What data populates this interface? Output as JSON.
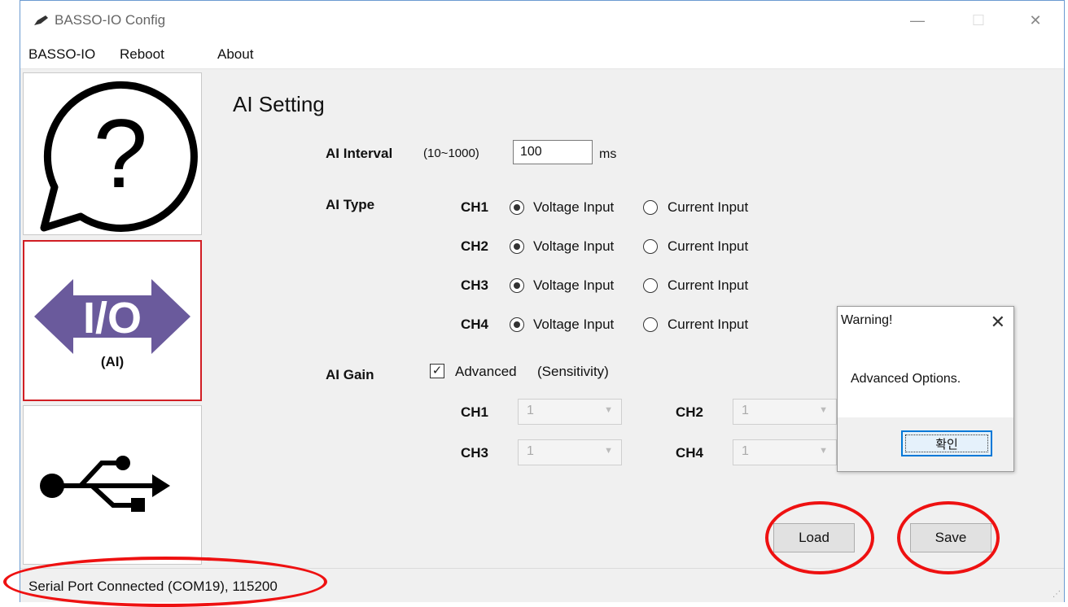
{
  "window": {
    "title": "BASSO-IO Config",
    "controls": {
      "minimize": "—",
      "maximize": "☐",
      "close": "✕"
    }
  },
  "menu": {
    "items": [
      "BASSO-IO",
      "Reboot",
      "About"
    ]
  },
  "sidebar": {
    "items": [
      {
        "name": "help",
        "icon": "question-bubble-icon"
      },
      {
        "name": "ai-io",
        "icon": "io-arrow-icon",
        "caption": "(AI)",
        "selected": true
      },
      {
        "name": "usb",
        "icon": "usb-icon"
      }
    ]
  },
  "main": {
    "section_title": "AI Setting",
    "interval": {
      "label": "AI Interval",
      "range": "(10~1000)",
      "value": "100",
      "unit": "ms"
    },
    "type": {
      "label": "AI Type",
      "option_labels": [
        "Voltage Input",
        "Current Input"
      ],
      "channels": [
        {
          "name": "CH1",
          "selected": "Voltage Input"
        },
        {
          "name": "CH2",
          "selected": "Voltage Input"
        },
        {
          "name": "CH3",
          "selected": "Voltage Input"
        },
        {
          "name": "CH4",
          "selected": "Voltage Input"
        }
      ]
    },
    "gain": {
      "label": "AI Gain",
      "advanced_label": "Advanced",
      "advanced_checked": true,
      "note": "(Sensitivity)",
      "channels": [
        {
          "name": "CH1",
          "value": "1"
        },
        {
          "name": "CH2",
          "value": "1"
        },
        {
          "name": "CH3",
          "value": "1"
        },
        {
          "name": "CH4",
          "value": "1"
        }
      ]
    },
    "buttons": {
      "load": "Load",
      "save": "Save"
    }
  },
  "status": {
    "text": "Serial Port Connected (COM19), 115200"
  },
  "dialog": {
    "title": "Warning!",
    "message": "Advanced Options.",
    "ok": "확인",
    "close": "✕"
  },
  "colors": {
    "highlight_red": "#e11111",
    "selected_border": "#d11e24",
    "io_purple": "#6a5a9c",
    "dialog_focus": "#0078d7"
  }
}
